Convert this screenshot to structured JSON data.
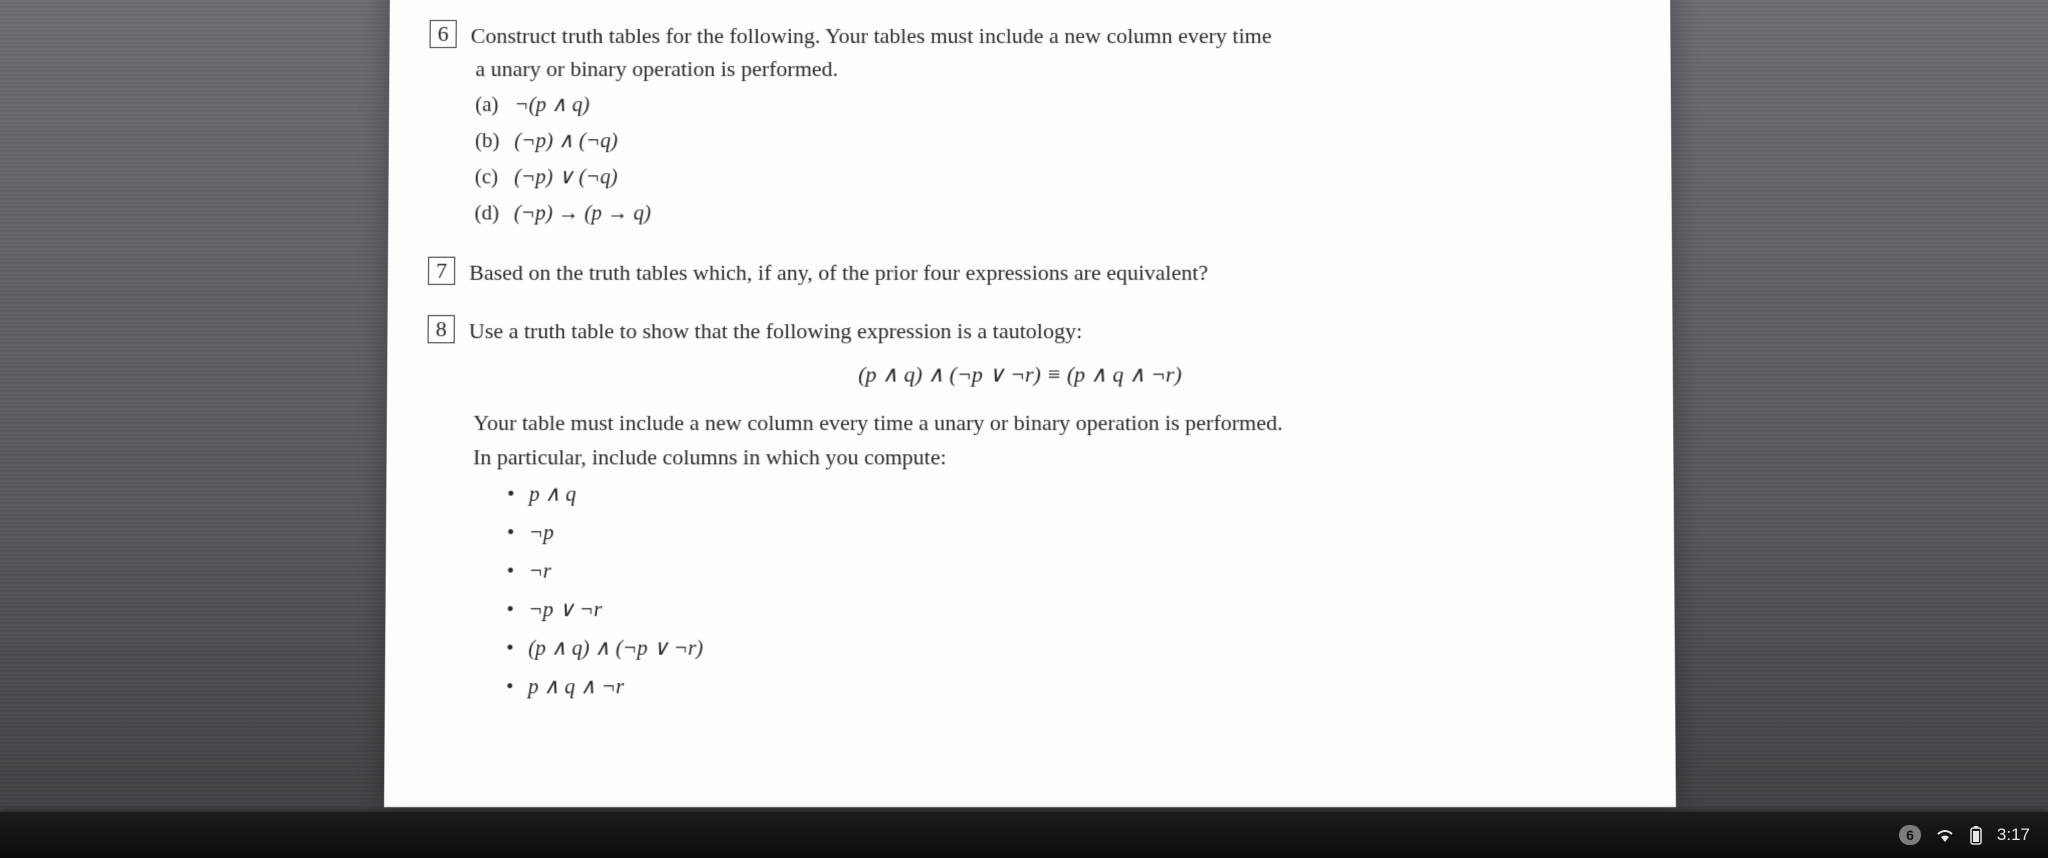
{
  "problems": {
    "p6": {
      "number": "6",
      "prompt_a": "Construct truth tables for the following. Your tables must include a new column every time",
      "prompt_b": "a unary or binary operation is performed.",
      "items": {
        "a_lbl": "(a)",
        "a_expr": "¬(p ∧ q)",
        "b_lbl": "(b)",
        "b_expr": "(¬p) ∧ (¬q)",
        "c_lbl": "(c)",
        "c_expr": "(¬p) ∨ (¬q)",
        "d_lbl": "(d)",
        "d_expr": "(¬p) → (p → q)"
      }
    },
    "p7": {
      "number": "7",
      "prompt": "Based on the truth tables which, if any, of the prior four expressions are equivalent?"
    },
    "p8": {
      "number": "8",
      "prompt": "Use a truth table to show that the following expression is a tautology:",
      "formula": "(p ∧ q) ∧ (¬p ∨ ¬r) ≡ (p ∧ q ∧ ¬r)",
      "note_a": "Your table must include a new column every time a unary or binary operation is performed.",
      "note_b": "In particular, include columns in which you compute:",
      "bullets": {
        "b1": "p ∧ q",
        "b2": "¬p",
        "b3": "¬r",
        "b4": "¬p ∨ ¬r",
        "b5": "(p ∧ q) ∧ (¬p ∨ ¬r)",
        "b6": "p ∧ q ∧ ¬r"
      }
    }
  },
  "taskbar": {
    "badge": "6",
    "clock": "3:17"
  }
}
